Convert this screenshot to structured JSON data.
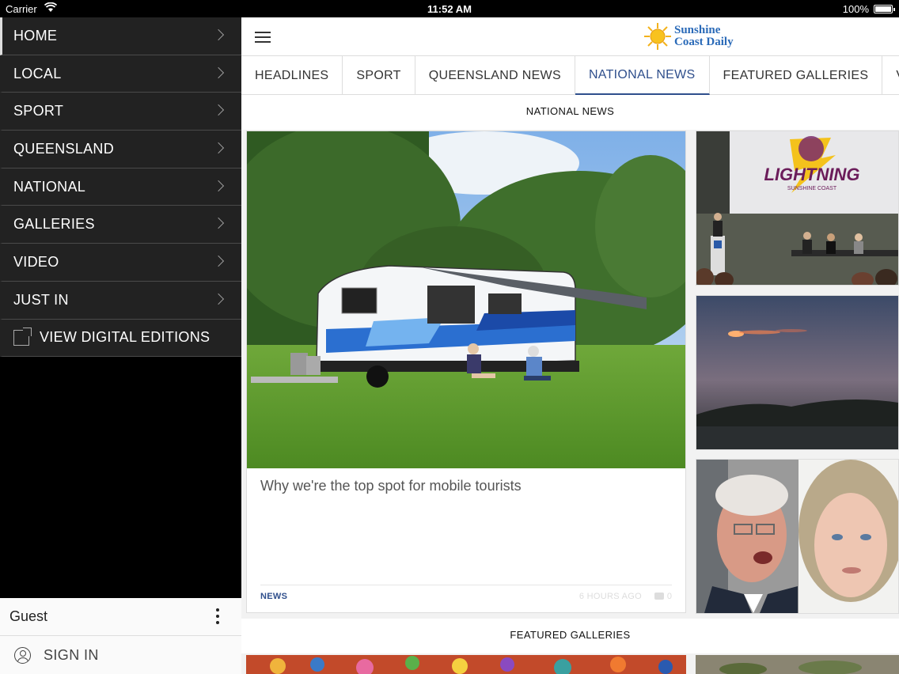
{
  "status_bar": {
    "carrier": "Carrier",
    "time": "11:52 AM",
    "battery": "100%"
  },
  "sidebar": {
    "items": [
      {
        "label": "HOME"
      },
      {
        "label": "LOCAL"
      },
      {
        "label": "SPORT"
      },
      {
        "label": "QUEENSLAND"
      },
      {
        "label": "NATIONAL"
      },
      {
        "label": "GALLERIES"
      },
      {
        "label": "VIDEO"
      },
      {
        "label": "JUST IN"
      },
      {
        "label": "VIEW DIGITAL EDITIONS"
      }
    ],
    "user": {
      "name": "Guest",
      "sign_in": "SIGN IN"
    }
  },
  "header": {
    "logo_line1": "Sunshine",
    "logo_line2": "Coast Daily"
  },
  "tabs": [
    {
      "label": "HEADLINES"
    },
    {
      "label": "SPORT"
    },
    {
      "label": "QUEENSLAND NEWS"
    },
    {
      "label": "NATIONAL NEWS",
      "active": true
    },
    {
      "label": "FEATURED GALLERIES"
    },
    {
      "label": "VIDEO"
    }
  ],
  "section": {
    "title": "NATIONAL NEWS"
  },
  "hero_article": {
    "headline": "Why we're the top spot for mobile tourists",
    "category": "NEWS",
    "time": "6 HOURS AGO",
    "comments": "0"
  },
  "side_tiles": {
    "lightning_logo": "LIGHTNING",
    "lightning_sub": "SUNSHINE COAST"
  },
  "featured": {
    "title": "FEATURED GALLERIES"
  },
  "colors": {
    "accent": "#2f4f8c",
    "sidebar_bg": "#222222",
    "logo_blue": "#2a6ab8"
  }
}
